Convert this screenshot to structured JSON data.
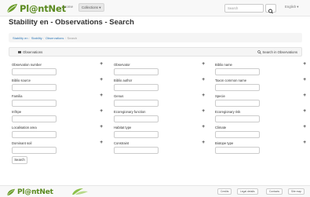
{
  "header": {
    "logo_text": "Pl@ntNet",
    "home_label": "Home",
    "collections_label": "Collections ▾",
    "search_placeholder": "Search",
    "language_label": "English ▾"
  },
  "page_title": "Stability en - Observations - Search",
  "breadcrumb": {
    "items": [
      "Stability en",
      "Stability",
      "Observations",
      "Search"
    ],
    "separator": "/"
  },
  "tabbar": {
    "observations_label": "Observations",
    "search_in_label": "Search in Observations"
  },
  "form": {
    "fields": [
      {
        "label": "Observation number"
      },
      {
        "label": "Observator"
      },
      {
        "label": "Biblio name"
      },
      {
        "label": "Biblio source"
      },
      {
        "label": "Biblio author"
      },
      {
        "label": "Taxon common name"
      },
      {
        "label": "Familia"
      },
      {
        "label": "Genus"
      },
      {
        "label": "Specie"
      },
      {
        "label": "InfSpe"
      },
      {
        "label": "Ecoregionary function"
      },
      {
        "label": "Ecoregionary risk"
      },
      {
        "label": "Localisation area"
      },
      {
        "label": "Habitat type"
      },
      {
        "label": "Climate"
      },
      {
        "label": "Dominant soil"
      },
      {
        "label": "Constraint"
      },
      {
        "label": "Biotope type"
      }
    ],
    "plus_symbol": "+",
    "search_button": "Search"
  },
  "footer": {
    "logo_text": "Pl@ntNet",
    "links": [
      "Credits",
      "Legal details",
      "Contacts",
      "Site map"
    ]
  },
  "colors": {
    "brand_green": "#5a8a1f",
    "link_blue": "#337ab7"
  }
}
